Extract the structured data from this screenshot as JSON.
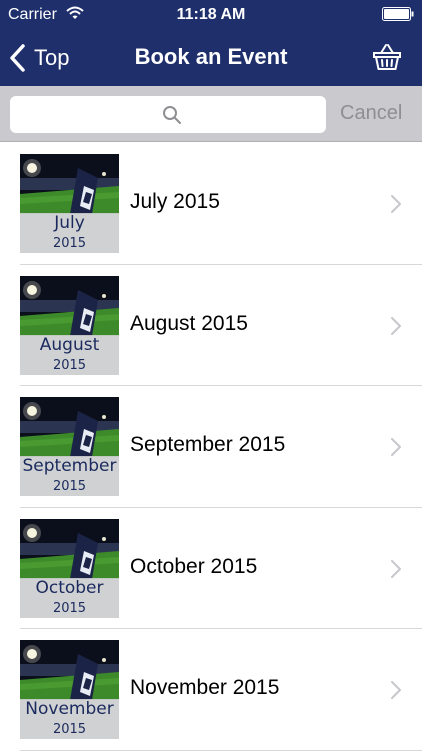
{
  "status_bar": {
    "carrier": "Carrier",
    "time": "11:18 AM",
    "icons": [
      "wifi-icon",
      "battery-icon"
    ]
  },
  "nav": {
    "back_label": "Top",
    "title": "Book an Event",
    "basket_icon": "basket-icon"
  },
  "search": {
    "placeholder": "",
    "icon": "search-icon",
    "cancel_label": "Cancel"
  },
  "colors": {
    "header": "#1f2f6b",
    "search_bar": "#c9c9ce",
    "cancel": "#8e8e93"
  },
  "events": [
    {
      "label": "July 2015",
      "thumb_month": "July",
      "thumb_year": "2015"
    },
    {
      "label": "August 2015",
      "thumb_month": "August",
      "thumb_year": "2015"
    },
    {
      "label": "September 2015",
      "thumb_month": "September",
      "thumb_year": "2015"
    },
    {
      "label": "October 2015",
      "thumb_month": "October",
      "thumb_year": "2015"
    },
    {
      "label": "November 2015",
      "thumb_month": "November",
      "thumb_year": "2015"
    }
  ]
}
